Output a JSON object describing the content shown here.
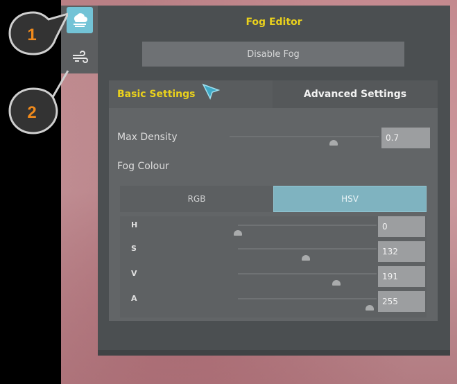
{
  "panel": {
    "title": "Fog Editor",
    "disable_button": "Disable Fog"
  },
  "tool_strip": {
    "items": [
      {
        "icon": "cloud-icon",
        "active": true
      },
      {
        "icon": "wind-icon",
        "active": false
      }
    ]
  },
  "callouts": [
    "1",
    "2"
  ],
  "tabs": {
    "basic": "Basic Settings",
    "advanced": "Advanced Settings"
  },
  "max_density": {
    "label": "Max Density",
    "value": "0.7",
    "level": 0.7
  },
  "fog_colour": {
    "label": "Fog Colour",
    "modes": [
      "RGB",
      "HSV"
    ],
    "selected_mode": "HSV",
    "channels": [
      {
        "label": "H",
        "value": "0",
        "level": 0.0
      },
      {
        "label": "S",
        "value": "132",
        "level": 0.52
      },
      {
        "label": "V",
        "value": "191",
        "level": 0.75
      },
      {
        "label": "A",
        "value": "255",
        "level": 1.0
      }
    ]
  },
  "colors": {
    "accent_yellow": "#ead11c",
    "selected_blue": "#73c3d6",
    "callout_orange": "#f08a1c"
  }
}
